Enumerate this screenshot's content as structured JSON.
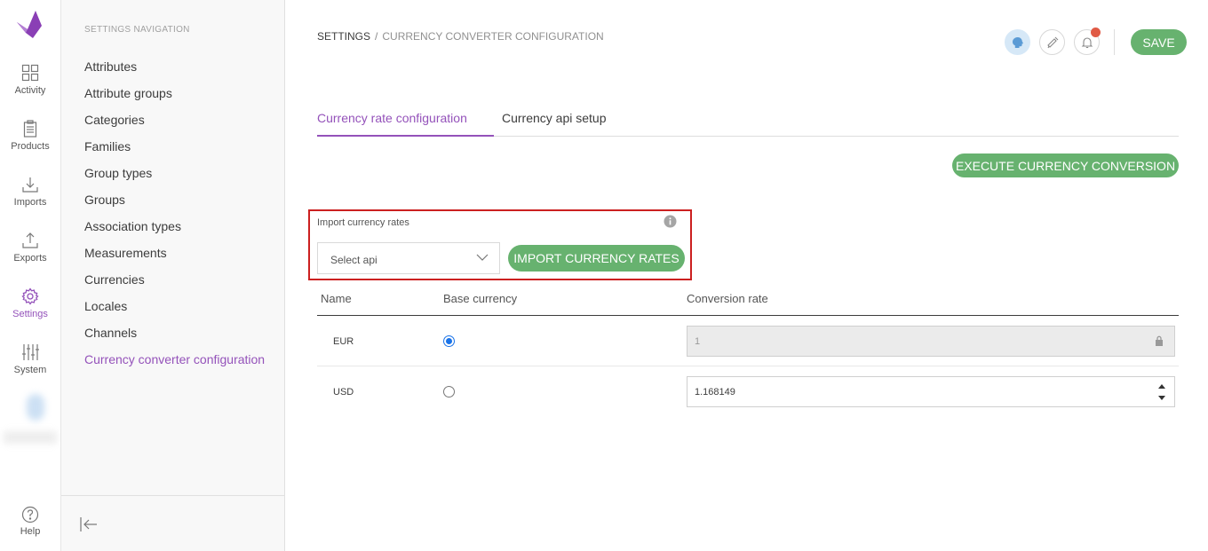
{
  "rail": {
    "items": [
      {
        "label": "Activity",
        "icon": "activity-grid-icon"
      },
      {
        "label": "Products",
        "icon": "products-clipboard-icon"
      },
      {
        "label": "Imports",
        "icon": "imports-download-icon"
      },
      {
        "label": "Exports",
        "icon": "exports-upload-icon"
      },
      {
        "label": "Settings",
        "icon": "settings-gear-icon"
      },
      {
        "label": "System",
        "icon": "system-sliders-icon"
      }
    ],
    "help_label": "Help"
  },
  "subnav": {
    "title": "SETTINGS NAVIGATION",
    "items": [
      "Attributes",
      "Attribute groups",
      "Categories",
      "Families",
      "Group types",
      "Groups",
      "Association types",
      "Measurements",
      "Currencies",
      "Locales",
      "Channels",
      "Currency converter configuration"
    ],
    "active_item": "Currency converter configuration"
  },
  "breadcrumb": {
    "root": "SETTINGS",
    "separator": "/",
    "current": "CURRENCY CONVERTER CONFIGURATION"
  },
  "header": {
    "save_label": "SAVE"
  },
  "tabs": [
    {
      "label": "Currency rate configuration",
      "active": true
    },
    {
      "label": "Currency api setup",
      "active": false
    }
  ],
  "execute_button_label": "EXECUTE CURRENCY CONVERSION",
  "import": {
    "label": "Import currency rates",
    "select_placeholder": "Select api",
    "button_label": "IMPORT CURRENCY RATES"
  },
  "table": {
    "headers": [
      "Name",
      "Base currency",
      "Conversion rate"
    ],
    "rows": [
      {
        "code": "EUR",
        "base": true,
        "rate": "1",
        "locked": true
      },
      {
        "code": "USD",
        "base": false,
        "rate": "1.168149",
        "locked": false
      }
    ]
  },
  "colors": {
    "accent": "#9452ba",
    "button_green": "#67b26f",
    "highlight_border": "#cc2020",
    "notification": "#e05a45"
  }
}
